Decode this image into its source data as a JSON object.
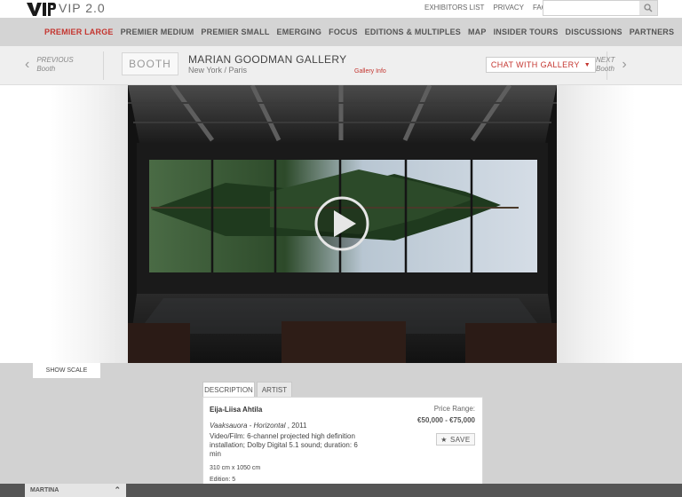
{
  "header": {
    "brand": "VIP 2.0",
    "links": [
      "EXHIBITORS LIST",
      "PRIVACY",
      "FAQ"
    ],
    "search_placeholder": "",
    "search_icon": "search-icon"
  },
  "nav": {
    "items": [
      "PREMIER LARGE",
      "PREMIER MEDIUM",
      "PREMIER SMALL",
      "EMERGING",
      "FOCUS",
      "EDITIONS & MULTIPLES",
      "MAP",
      "INSIDER TOURS",
      "DISCUSSIONS",
      "PARTNERS"
    ],
    "active_index": 0
  },
  "booth_bar": {
    "previous_label": "PREVIOUS",
    "previous_sub": "Booth",
    "next_label": "NEXT",
    "next_sub": "Booth",
    "booth_label": "BOOTH",
    "gallery_name": "MARIAN GOODMAN GALLERY",
    "gallery_location": "New York / Paris",
    "gallery_info": "Gallery Info",
    "chat_label": "CHAT WITH GALLERY"
  },
  "stage": {
    "show_scale": "SHOW SCALE",
    "play_icon": "play-icon"
  },
  "tabs": [
    "DESCRIPTION",
    "ARTIST"
  ],
  "artwork": {
    "artist": "Eija-Liisa Ahtila",
    "title": "Vaaksauora - Horizontal",
    "year": " , 2011",
    "medium": "Video/Film: 6-channel projected high definition installation; Dolby Digital 5.1 sound; duration: 6 min",
    "dimensions": "310 cm x 1050 cm",
    "edition": "Edition: 5",
    "price_label": "Price Range:",
    "price_value": "€50,000 - €75,000",
    "save_label": "SAVE"
  },
  "footer": {
    "user_name": "MARTINA"
  },
  "colors": {
    "accent": "#c4352f",
    "nav_bg": "#d4d4d4",
    "footer_bg": "#555555"
  }
}
